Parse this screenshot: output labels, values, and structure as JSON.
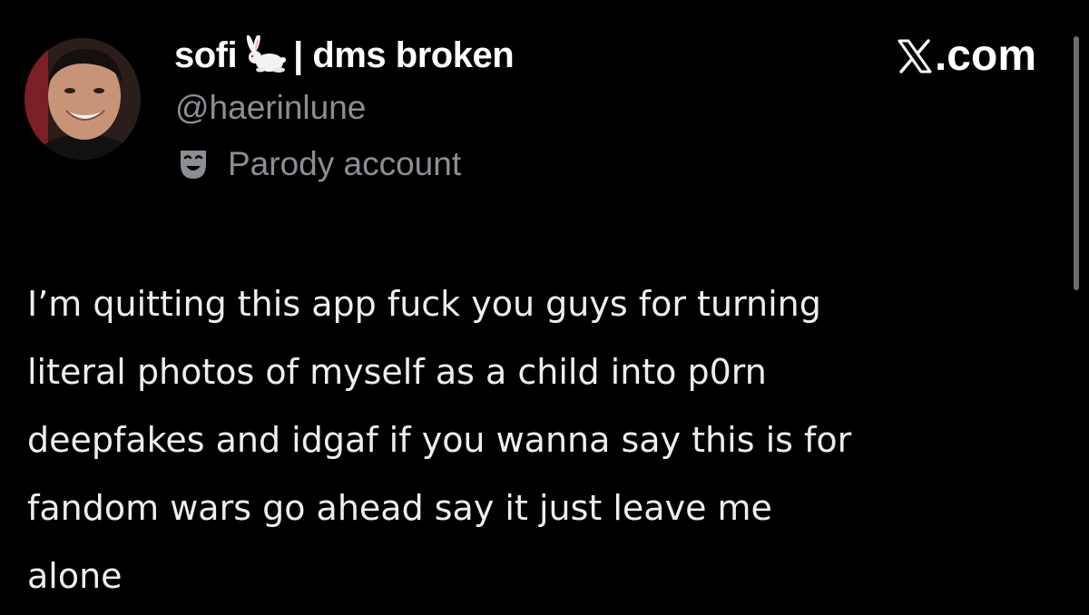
{
  "header": {
    "display_name": "sofi",
    "display_name_suffix": "| dms broken",
    "name_emoji_icon": "rabbit-icon",
    "handle": "@haerinlune",
    "badge_label": "Parody account",
    "badge_icon": "parody-mask-icon",
    "site_label": ".com",
    "site_icon": "x-logo-icon"
  },
  "tweet": {
    "lines": [
      "I’m quitting this app fuck you guys for turning",
      "literal photos of myself as a child into p0rn",
      "deepfakes and idgaf if you wanna say this is for",
      "fandom wars go ahead say it just leave me",
      "alone"
    ]
  },
  "colors": {
    "background": "#000000",
    "primary_text": "#ffffff",
    "secondary_text": "#8b8f94",
    "body_text": "#eceeef",
    "scrollbar": "#6b6e72"
  }
}
